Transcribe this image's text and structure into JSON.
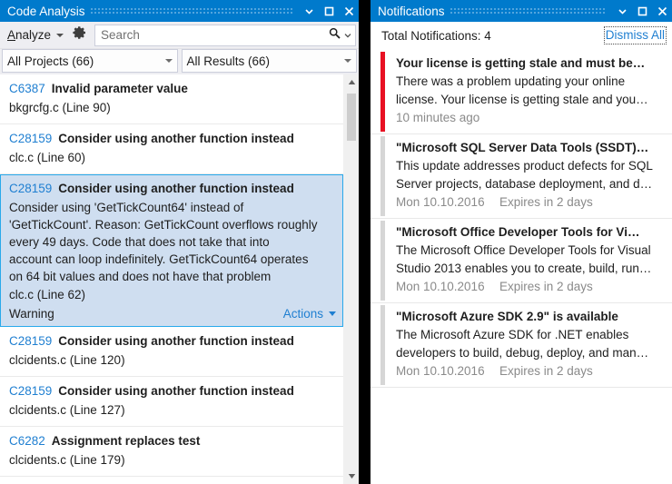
{
  "code_analysis": {
    "title": "Code Analysis",
    "titlebar_icons": [
      "chevron-down-icon",
      "maximize-icon",
      "close-icon"
    ],
    "toolbar": {
      "analyze_label": "Analyze",
      "analyze_accel": "A",
      "analyze_rest": "nalyze",
      "gear_icon": "gear-icon",
      "search_placeholder": "Search",
      "search_value": "",
      "search_icon": "search-icon"
    },
    "filters": [
      {
        "label": "All Projects (66)"
      },
      {
        "label": "All Results (66)"
      }
    ],
    "issues": [
      {
        "code": "C6387",
        "title": "Invalid parameter value",
        "location": "bkgrcfg.c (Line 90)",
        "selected": false
      },
      {
        "code": "C28159",
        "title": "Consider using another function instead",
        "location": "clc.c (Line 60)",
        "selected": false
      },
      {
        "code": "C28159",
        "title": "Consider using another function instead",
        "description": "Consider using 'GetTickCount64' instead of\n'GetTickCount'. Reason: GetTickCount overflows roughly\nevery 49 days.  Code that does not take that into\naccount can loop indefinitely.  GetTickCount64 operates\non 64 bit values and does not have that problem",
        "location": "clc.c (Line 62)",
        "severity": "Warning",
        "actions_label": "Actions",
        "selected": true
      },
      {
        "code": "C28159",
        "title": "Consider using another function instead",
        "location": "clcidents.c (Line 120)",
        "selected": false
      },
      {
        "code": "C28159",
        "title": "Consider using another function instead",
        "location": "clcidents.c (Line 127)",
        "selected": false
      },
      {
        "code": "C6282",
        "title": "Assignment replaces test",
        "location": "clcidents.c (Line 179)",
        "selected": false
      }
    ]
  },
  "notifications": {
    "title": "Notifications",
    "titlebar_icons": [
      "chevron-down-icon",
      "maximize-icon",
      "close-icon"
    ],
    "total_label": "Total Notifications: 4",
    "dismiss_all_label": "Dismiss All",
    "items": [
      {
        "title": "Your license is getting stale and must be…",
        "description": "There was a problem updating your online\nlicense. Your license is getting stale and you…",
        "date": "10 minutes ago",
        "expires": "",
        "accent": "#e81123"
      },
      {
        "title": "\"Microsoft SQL Server Data Tools (SSDT)…",
        "description": "This update addresses product defects for SQL\nServer projects, database deployment, and d…",
        "date": "Mon 10.10.2016",
        "expires": "Expires in 2 days",
        "accent": "#d6d6d6"
      },
      {
        "title": "\"Microsoft Office Developer Tools for Vi…",
        "description": "The Microsoft Office Developer Tools for Visual\nStudio 2013 enables you to create, build, run…",
        "date": "Mon 10.10.2016",
        "expires": "Expires in 2 days",
        "accent": "#d6d6d6"
      },
      {
        "title": "\"Microsoft Azure SDK 2.9\" is available",
        "description": "The Microsoft Azure SDK for .NET enables\ndevelopers to build, debug, deploy, and man…",
        "date": "Mon 10.10.2016",
        "expires": "Expires in 2 days",
        "accent": "#d6d6d6"
      }
    ]
  },
  "colors": {
    "titlebar": "#007acc",
    "accent_link": "#1f7fd1",
    "selection_bg": "#cfdef0",
    "selection_border": "#29a9eb",
    "error_accent": "#e81123"
  }
}
